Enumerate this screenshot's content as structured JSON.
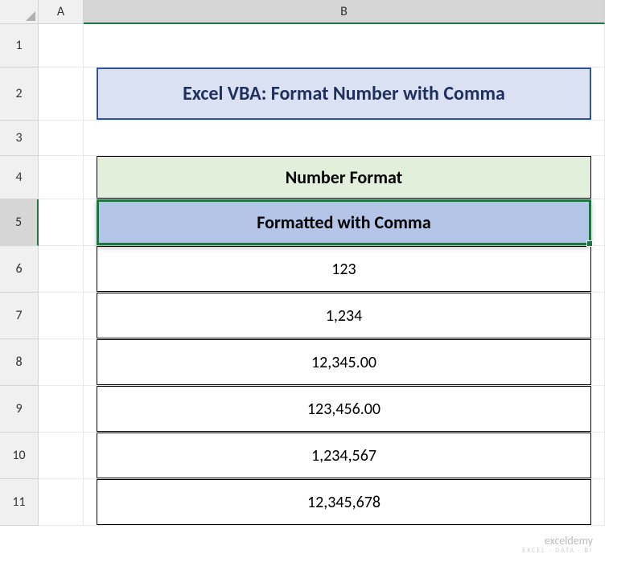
{
  "columnHeaders": {
    "A": "A",
    "B": "B"
  },
  "rowHeaders": {
    "r1": "1",
    "r2": "2",
    "r3": "3",
    "r4": "4",
    "r5": "5",
    "r6": "6",
    "r7": "7",
    "r8": "8",
    "r9": "9",
    "r10": "10",
    "r11": "11"
  },
  "cells": {
    "b2": "Excel VBA: Format Number with Comma",
    "b4": "Number Format",
    "b5": "Formatted with Comma",
    "b6": "123",
    "b7": "1,234",
    "b8": "12,345.00",
    "b9": "123,456.00",
    "b10": "1,234,567",
    "b11": "12,345,678"
  },
  "watermark": {
    "main": "exceldemy",
    "sub": "EXCEL · DATA · BI"
  }
}
